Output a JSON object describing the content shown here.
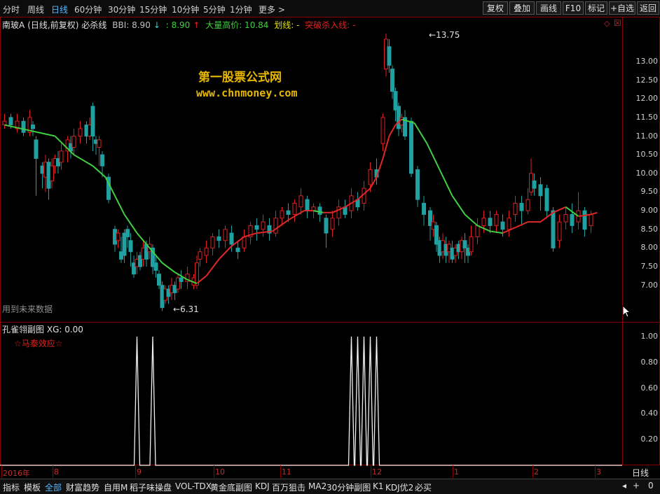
{
  "periods": [
    {
      "label": "分时",
      "active": false
    },
    {
      "label": "周线",
      "active": false
    },
    {
      "label": "日线",
      "active": true
    },
    {
      "label": "60分钟",
      "active": false
    },
    {
      "label": "30分钟",
      "active": false
    },
    {
      "label": "15分钟",
      "active": false
    },
    {
      "label": "10分钟",
      "active": false
    },
    {
      "label": "5分钟",
      "active": false
    },
    {
      "label": "1分钟",
      "active": false
    },
    {
      "label": "更多 >",
      "active": false
    }
  ],
  "tools": [
    "复权",
    "叠加",
    "画线",
    "F10",
    "标记",
    "+自选",
    "返回"
  ],
  "info": {
    "stock": "南玻A",
    "mode": "(日线,前复权)",
    "indicator": "必杀线",
    "bbi": "BBI: 8.90",
    "bbi2": ": 8.90",
    "big_vol_price": "大量高价: 10.84",
    "line_label": "划线: -",
    "breakout": "突破杀入线: -"
  },
  "watermark": {
    "line1": "第一股票公式网",
    "line2": "www.chnmoney.com"
  },
  "notice": "用到未来数据",
  "price_high": "13.75",
  "price_low": "6.31",
  "main_y_ticks": [
    "13.00",
    "12.50",
    "12.00",
    "11.50",
    "11.00",
    "10.50",
    "10.00",
    "9.50",
    "9.00",
    "8.50",
    "8.00",
    "7.50",
    "7.00"
  ],
  "x_ticks": [
    "2016年",
    "8",
    "9",
    "10",
    "11",
    "12",
    "1",
    "2",
    "3"
  ],
  "sub": {
    "title": "孔雀翎副图",
    "xg": "XG: 0.00",
    "label": "☆马泰效应☆",
    "y_ticks": [
      "1.00",
      "0.80",
      "0.60",
      "0.40",
      "0.20"
    ]
  },
  "period_label": "日线",
  "bottom_tabs": [
    {
      "label": "指标",
      "active": false
    },
    {
      "label": "模板",
      "active": false
    },
    {
      "label": "全部",
      "active": true
    },
    {
      "label": "财富趋势",
      "active": false
    },
    {
      "label": "自用M",
      "active": false
    },
    {
      "label": "稻子味操盘",
      "active": false
    },
    {
      "label": "VOL-TDX",
      "active": false
    },
    {
      "label": "黄金底副图",
      "active": false
    },
    {
      "label": "KDJ",
      "active": false
    },
    {
      "label": "百万狙击",
      "active": false
    },
    {
      "label": "MA2",
      "active": false
    },
    {
      "label": "30分钟副图",
      "active": false
    },
    {
      "label": "K1",
      "active": false
    },
    {
      "label": "KDJ优2",
      "active": false
    },
    {
      "label": "必买",
      "active": false
    }
  ],
  "colors": {
    "up": "#e02020",
    "down": "#20a0a0",
    "line_up": "#e02828",
    "line_down": "#40d040",
    "frame": "#8a0000"
  },
  "chart_data": [
    {
      "type": "candlestick",
      "series": [
        {
          "name": "BBI",
          "points": [
            [
              0,
              11.3
            ],
            [
              8,
              11.15
            ],
            [
              16,
              11.0
            ],
            [
              22,
              10.5
            ],
            [
              28,
              10.2
            ],
            [
              32,
              9.9
            ],
            [
              35,
              9.4
            ],
            [
              38,
              8.9
            ],
            [
              42,
              8.4
            ],
            [
              46,
              8.0
            ],
            [
              50,
              7.6
            ],
            [
              54,
              7.35
            ],
            [
              58,
              7.15
            ],
            [
              61,
              7.05
            ],
            [
              64,
              7.25
            ],
            [
              68,
              7.7
            ],
            [
              72,
              8.05
            ],
            [
              76,
              8.3
            ],
            [
              80,
              8.4
            ],
            [
              85,
              8.45
            ],
            [
              90,
              8.75
            ],
            [
              95,
              9.0
            ],
            [
              98,
              9.0
            ],
            [
              101,
              8.95
            ],
            [
              104,
              8.95
            ],
            [
              108,
              9.1
            ],
            [
              112,
              9.3
            ],
            [
              116,
              9.6
            ],
            [
              118,
              9.9
            ],
            [
              120,
              10.4
            ],
            [
              122,
              11.0
            ],
            [
              124,
              11.3
            ],
            [
              126,
              11.45
            ],
            [
              130,
              11.35
            ],
            [
              134,
              10.8
            ],
            [
              138,
              10.1
            ],
            [
              142,
              9.4
            ],
            [
              146,
              8.9
            ],
            [
              150,
              8.6
            ],
            [
              154,
              8.45
            ],
            [
              158,
              8.4
            ],
            [
              162,
              8.55
            ],
            [
              166,
              8.7
            ],
            [
              170,
              8.7
            ],
            [
              174,
              8.95
            ],
            [
              178,
              9.1
            ],
            [
              182,
              8.85
            ],
            [
              186,
              8.9
            ],
            [
              188,
              8.95
            ]
          ]
        }
      ],
      "candles": [
        [
          0,
          11.3,
          11.4,
          11.6,
          11.2
        ],
        [
          2,
          11.5,
          11.3,
          11.6,
          11.2
        ],
        [
          4,
          11.2,
          11.4,
          11.6,
          11.1
        ],
        [
          6,
          11.4,
          11.1,
          11.5,
          11.0
        ],
        [
          8,
          11.1,
          11.5,
          11.7,
          11.0
        ],
        [
          9,
          11.3,
          11.2,
          11.4,
          11.0
        ],
        [
          10,
          10.9,
          10.4,
          11.0,
          9.4
        ],
        [
          12,
          10.2,
          10.0,
          10.3,
          9.6
        ],
        [
          13,
          9.9,
          10.3,
          10.5,
          9.5
        ],
        [
          14,
          10.3,
          9.6,
          10.4,
          9.3
        ],
        [
          15,
          9.8,
          10.2,
          10.4,
          9.6
        ],
        [
          16,
          10.2,
          10.4,
          10.5,
          10.0
        ],
        [
          17,
          10.4,
          10.2,
          10.6,
          10.0
        ],
        [
          18,
          10.3,
          10.6,
          10.8,
          10.1
        ],
        [
          20,
          10.6,
          10.9,
          11.0,
          10.3
        ],
        [
          21,
          10.8,
          10.6,
          11.0,
          10.4
        ],
        [
          22,
          10.7,
          11.0,
          11.2,
          10.5
        ],
        [
          24,
          11.0,
          11.2,
          11.4,
          10.8
        ],
        [
          26,
          11.3,
          11.0,
          11.4,
          10.8
        ],
        [
          27,
          11.0,
          11.3,
          11.5,
          10.9
        ],
        [
          28,
          11.8,
          11.0,
          11.9,
          10.6
        ],
        [
          29,
          10.9,
          10.8,
          11.0,
          10.5
        ],
        [
          30,
          10.7,
          10.9,
          11.0,
          10.2
        ],
        [
          31,
          10.5,
          10.2,
          10.6,
          9.9
        ],
        [
          33,
          9.9,
          9.3,
          10.0,
          9.2
        ],
        [
          35,
          8.5,
          8.1,
          8.6,
          7.9
        ],
        [
          36,
          8.2,
          8.4,
          8.5,
          8.0
        ],
        [
          37,
          7.9,
          7.7,
          8.3,
          7.6
        ],
        [
          38,
          8.4,
          7.8,
          8.5,
          7.6
        ],
        [
          39,
          8.5,
          8.3,
          8.6,
          8.0
        ],
        [
          40,
          8.2,
          7.9,
          8.4,
          7.5
        ],
        [
          41,
          7.6,
          7.3,
          7.8,
          7.2
        ],
        [
          42,
          7.5,
          7.7,
          7.9,
          7.3
        ],
        [
          43,
          7.8,
          7.5,
          7.9,
          7.4
        ],
        [
          44,
          7.7,
          8.0,
          8.2,
          7.5
        ],
        [
          45,
          8.1,
          7.7,
          8.2,
          7.5
        ],
        [
          46,
          7.9,
          8.1,
          8.3,
          7.7
        ],
        [
          47,
          8.0,
          7.5,
          8.1,
          7.3
        ],
        [
          48,
          7.6,
          7.4,
          7.8,
          7.2
        ],
        [
          49,
          7.3,
          7.0,
          7.4,
          6.9
        ],
        [
          50,
          7.0,
          6.4,
          7.1,
          6.31
        ],
        [
          51,
          6.6,
          6.9,
          7.0,
          6.5
        ],
        [
          52,
          6.9,
          6.7,
          7.0,
          6.5
        ],
        [
          53,
          6.8,
          7.0,
          7.2,
          6.6
        ],
        [
          54,
          7.0,
          6.8,
          7.1,
          6.6
        ],
        [
          55,
          6.9,
          7.2,
          7.3,
          6.8
        ],
        [
          56,
          7.2,
          7.1,
          7.4,
          6.9
        ],
        [
          58,
          7.1,
          7.3,
          7.5,
          6.9
        ],
        [
          60,
          7.0,
          7.2,
          7.3,
          6.9
        ],
        [
          61,
          7.0,
          7.6,
          7.8,
          6.9
        ],
        [
          62,
          7.7,
          7.9,
          8.0,
          7.5
        ],
        [
          64,
          7.8,
          8.0,
          8.2,
          7.6
        ],
        [
          66,
          8.0,
          8.3,
          8.4,
          7.8
        ],
        [
          68,
          8.3,
          8.2,
          8.5,
          8.0
        ],
        [
          70,
          8.2,
          8.5,
          8.6,
          8.0
        ],
        [
          72,
          8.4,
          8.1,
          8.6,
          7.9
        ],
        [
          74,
          8.0,
          7.9,
          8.2,
          7.7
        ],
        [
          76,
          8.0,
          8.3,
          8.5,
          7.9
        ],
        [
          78,
          8.3,
          8.6,
          8.7,
          8.1
        ],
        [
          80,
          8.6,
          8.5,
          8.8,
          8.2
        ],
        [
          82,
          8.5,
          8.7,
          8.9,
          8.3
        ],
        [
          84,
          8.6,
          8.4,
          8.8,
          8.2
        ],
        [
          86,
          8.4,
          8.8,
          9.0,
          8.3
        ],
        [
          88,
          8.8,
          9.0,
          9.1,
          8.6
        ],
        [
          90,
          9.0,
          8.9,
          9.2,
          8.7
        ],
        [
          92,
          8.9,
          9.2,
          9.3,
          8.7
        ],
        [
          94,
          9.1,
          9.4,
          9.6,
          8.9
        ],
        [
          96,
          9.3,
          9.0,
          9.4,
          8.8
        ],
        [
          98,
          9.0,
          9.1,
          9.2,
          8.8
        ],
        [
          100,
          9.1,
          8.9,
          9.2,
          8.7
        ],
        [
          102,
          8.8,
          8.4,
          8.9,
          8.0
        ],
        [
          104,
          8.5,
          8.8,
          9.0,
          8.3
        ],
        [
          106,
          8.8,
          9.1,
          9.3,
          8.6
        ],
        [
          108,
          9.1,
          8.9,
          9.3,
          8.8
        ],
        [
          110,
          9.0,
          9.4,
          9.6,
          8.8
        ],
        [
          112,
          9.3,
          9.1,
          9.5,
          9.0
        ],
        [
          114,
          9.2,
          9.6,
          9.8,
          9.0
        ],
        [
          116,
          9.7,
          10.1,
          10.3,
          9.5
        ],
        [
          118,
          10.1,
          9.9,
          10.4,
          9.7
        ],
        [
          120,
          10.8,
          11.5,
          11.6,
          10.6
        ],
        [
          121,
          12.8,
          13.6,
          13.75,
          12.6
        ],
        [
          122,
          13.4,
          12.9,
          13.6,
          12.7
        ],
        [
          123,
          12.8,
          12.2,
          12.9,
          12.0
        ],
        [
          124,
          12.2,
          11.7,
          12.3,
          11.4
        ],
        [
          125,
          11.8,
          11.2,
          11.9,
          11.0
        ],
        [
          126,
          11.3,
          11.5,
          11.6,
          11.1
        ],
        [
          127,
          11.5,
          11.0,
          11.7,
          10.9
        ],
        [
          129,
          11.4,
          10.0,
          11.5,
          9.9
        ],
        [
          131,
          10.1,
          9.3,
          10.2,
          9.1
        ],
        [
          133,
          9.2,
          8.9,
          9.4,
          8.6
        ],
        [
          135,
          9.0,
          8.6,
          9.1,
          8.2
        ],
        [
          136,
          8.5,
          8.7,
          8.9,
          8.3
        ],
        [
          137,
          8.6,
          8.1,
          8.7,
          7.9
        ],
        [
          138,
          8.2,
          7.8,
          8.3,
          7.6
        ],
        [
          139,
          7.9,
          8.2,
          8.4,
          7.7
        ],
        [
          140,
          8.1,
          7.8,
          8.3,
          7.6
        ],
        [
          141,
          7.9,
          8.1,
          8.2,
          7.6
        ],
        [
          142,
          8.0,
          7.7,
          8.2,
          7.6
        ],
        [
          143,
          7.8,
          8.0,
          8.1,
          7.6
        ],
        [
          144,
          8.1,
          7.9,
          8.2,
          7.7
        ],
        [
          145,
          7.9,
          8.2,
          8.3,
          7.7
        ],
        [
          146,
          8.2,
          8.0,
          8.4,
          7.6
        ],
        [
          147,
          8.0,
          7.8,
          8.1,
          7.6
        ],
        [
          148,
          7.9,
          8.3,
          8.6,
          7.8
        ],
        [
          150,
          8.3,
          8.6,
          8.8,
          8.1
        ],
        [
          152,
          8.6,
          8.8,
          9.0,
          8.4
        ],
        [
          154,
          8.8,
          8.6,
          9.0,
          8.4
        ],
        [
          156,
          8.6,
          8.9,
          9.0,
          8.4
        ],
        [
          158,
          8.7,
          8.5,
          8.9,
          8.3
        ],
        [
          160,
          8.5,
          8.8,
          9.0,
          8.3
        ],
        [
          162,
          8.9,
          9.2,
          9.4,
          8.7
        ],
        [
          164,
          9.2,
          9.0,
          9.4,
          8.6
        ],
        [
          166,
          9.0,
          9.3,
          9.6,
          8.9
        ],
        [
          167,
          9.5,
          10.0,
          10.4,
          9.4
        ],
        [
          168,
          9.8,
          9.6,
          10.0,
          9.4
        ],
        [
          170,
          9.7,
          9.4,
          9.9,
          9.0
        ],
        [
          172,
          9.6,
          9.0,
          9.7,
          8.8
        ],
        [
          174,
          9.0,
          8.0,
          9.1,
          7.9
        ],
        [
          176,
          8.2,
          8.7,
          8.9,
          8.0
        ],
        [
          178,
          8.7,
          8.9,
          9.1,
          8.5
        ],
        [
          180,
          8.9,
          8.6,
          9.2,
          8.4
        ],
        [
          182,
          8.7,
          9.0,
          9.5,
          8.5
        ],
        [
          184,
          9.0,
          8.5,
          9.1,
          8.3
        ],
        [
          186,
          8.6,
          8.9,
          9.0,
          8.4
        ]
      ]
    },
    {
      "type": "line",
      "series": [
        {
          "name": "XG",
          "pulses": [
            42,
            47,
            110,
            112,
            114,
            116,
            118
          ]
        }
      ],
      "ylim": [
        0,
        1
      ]
    }
  ]
}
